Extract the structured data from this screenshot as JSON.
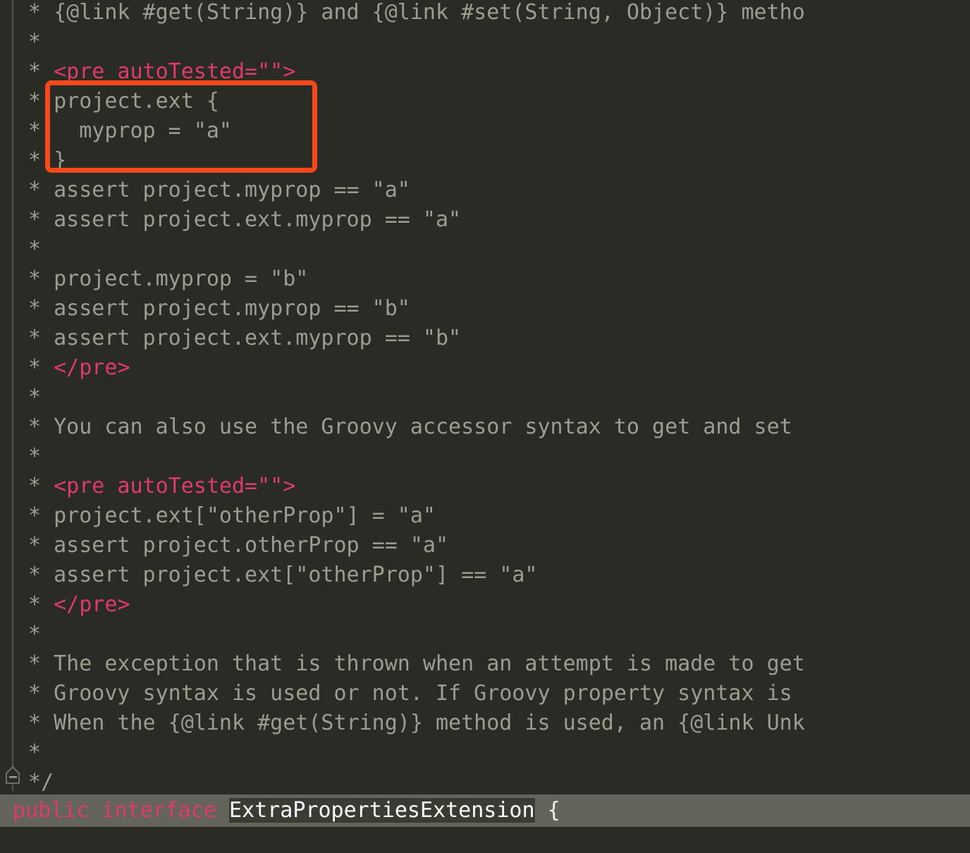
{
  "app": {
    "kind": "code-editor",
    "language": "java",
    "theme": {
      "background": "#2b2b26",
      "comment_text": "#9d9d8f",
      "tag_pink": "#e0396b",
      "annotation_orange": "#f9481a",
      "selection_background": "#64645a",
      "identifier_highlight_background": "#3b3b34",
      "identifier_text": "#ffffff",
      "gutter_rail": "#55554c"
    }
  },
  "gutter": {
    "fold_marker_icon": "fold-collapse-icon",
    "fold_marker_state": "expanded"
  },
  "annotation": {
    "shape": "rectangle",
    "color": "#f9481a",
    "encloses_lines": [
      3,
      4,
      5
    ],
    "encloses_text": "project.ext {\n  myprop = \"a\"\n}"
  },
  "code": {
    "lines": [
      {
        "prefix": "* ",
        "segments": [
          {
            "kind": "text",
            "text": "{@link #get(String)} and {@link #set(String, Object)} metho"
          }
        ]
      },
      {
        "prefix": "*",
        "segments": []
      },
      {
        "prefix": "* ",
        "segments": [
          {
            "kind": "tag",
            "text": "<pre autoTested=\"\">"
          }
        ]
      },
      {
        "prefix": "* ",
        "segments": [
          {
            "kind": "text",
            "text": "project.ext {"
          }
        ]
      },
      {
        "prefix": "* ",
        "segments": [
          {
            "kind": "text",
            "text": "  myprop = \"a\""
          }
        ]
      },
      {
        "prefix": "* ",
        "segments": [
          {
            "kind": "text",
            "text": "}"
          }
        ]
      },
      {
        "prefix": "* ",
        "segments": [
          {
            "kind": "text",
            "text": "assert project.myprop == \"a\""
          }
        ]
      },
      {
        "prefix": "* ",
        "segments": [
          {
            "kind": "text",
            "text": "assert project.ext.myprop == \"a\""
          }
        ]
      },
      {
        "prefix": "*",
        "segments": []
      },
      {
        "prefix": "* ",
        "segments": [
          {
            "kind": "text",
            "text": "project.myprop = \"b\""
          }
        ]
      },
      {
        "prefix": "* ",
        "segments": [
          {
            "kind": "text",
            "text": "assert project.myprop == \"b\""
          }
        ]
      },
      {
        "prefix": "* ",
        "segments": [
          {
            "kind": "text",
            "text": "assert project.ext.myprop == \"b\""
          }
        ]
      },
      {
        "prefix": "* ",
        "segments": [
          {
            "kind": "tag",
            "text": "</pre>"
          }
        ]
      },
      {
        "prefix": "*",
        "segments": []
      },
      {
        "prefix": "* ",
        "segments": [
          {
            "kind": "text",
            "text": "You can also use the Groovy accessor syntax to get and set"
          }
        ]
      },
      {
        "prefix": "*",
        "segments": []
      },
      {
        "prefix": "* ",
        "segments": [
          {
            "kind": "tag",
            "text": "<pre autoTested=\"\">"
          }
        ]
      },
      {
        "prefix": "* ",
        "segments": [
          {
            "kind": "text",
            "text": "project.ext[\"otherProp\"] = \"a\""
          }
        ]
      },
      {
        "prefix": "* ",
        "segments": [
          {
            "kind": "text",
            "text": "assert project.otherProp == \"a\""
          }
        ]
      },
      {
        "prefix": "* ",
        "segments": [
          {
            "kind": "text",
            "text": "assert project.ext[\"otherProp\"] == \"a\""
          }
        ]
      },
      {
        "prefix": "* ",
        "segments": [
          {
            "kind": "tag",
            "text": "</pre>"
          }
        ]
      },
      {
        "prefix": "*",
        "segments": []
      },
      {
        "prefix": "* ",
        "segments": [
          {
            "kind": "text",
            "text": "The exception that is thrown when an attempt is made to get"
          }
        ]
      },
      {
        "prefix": "* ",
        "segments": [
          {
            "kind": "text",
            "text": "Groovy syntax is used or not. If Groovy property syntax is "
          }
        ]
      },
      {
        "prefix": "* ",
        "segments": [
          {
            "kind": "text",
            "text": "When the {@link #get(String)} method is used, an {@link Unk"
          }
        ]
      },
      {
        "prefix": "*",
        "segments": []
      },
      {
        "prefix": "*/",
        "segments": []
      }
    ]
  },
  "declaration": {
    "keywords": "public interface",
    "identifier": "ExtraPropertiesExtension",
    "open_brace": "{",
    "highlighted": true
  }
}
